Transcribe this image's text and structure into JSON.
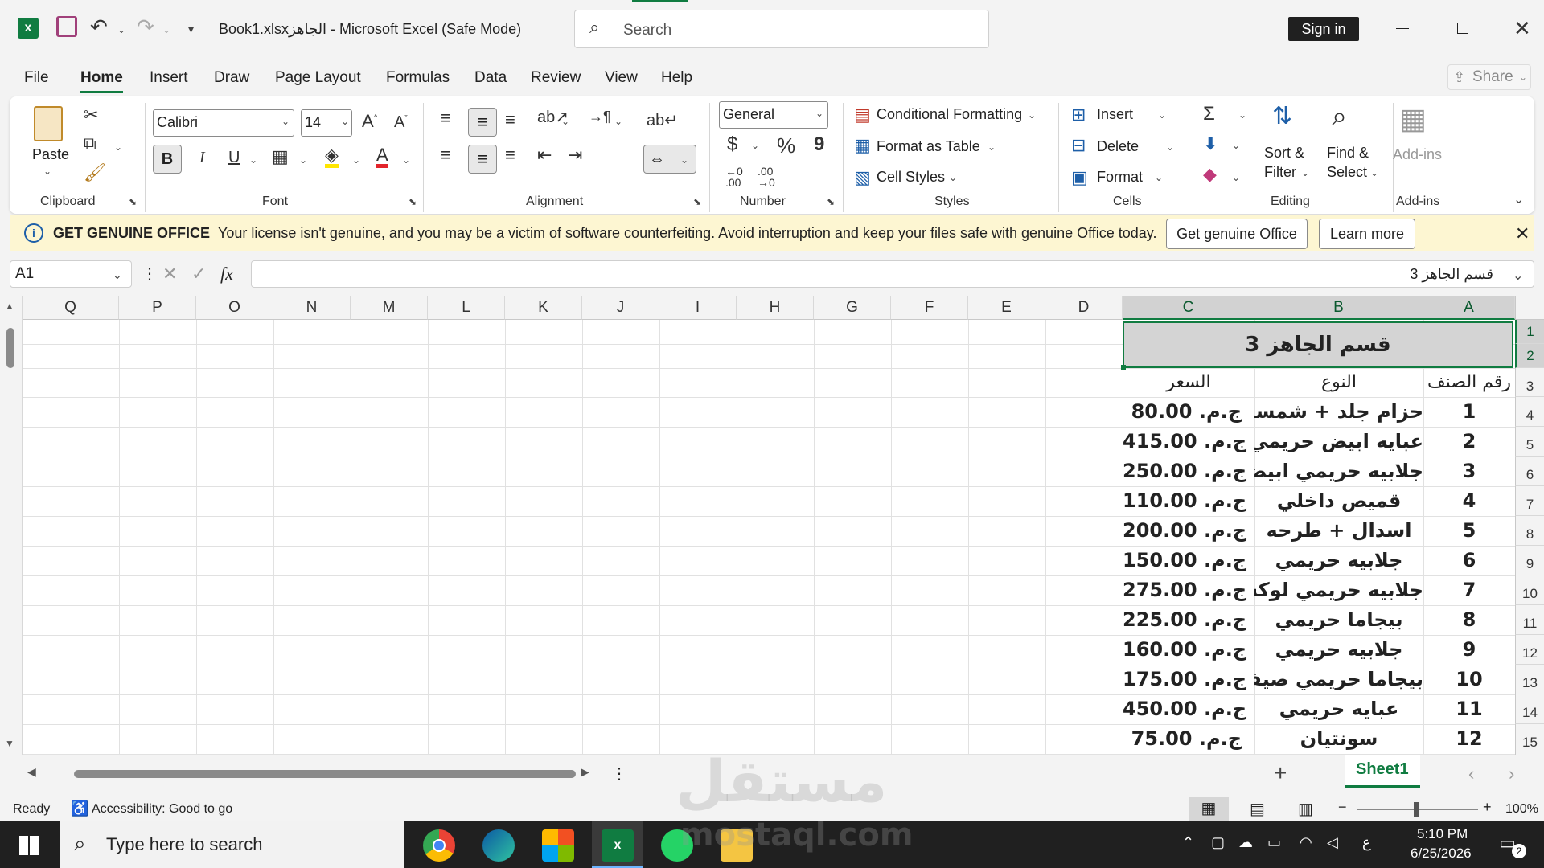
{
  "window": {
    "title": "Book1.xlsxالجاهز  -  Microsoft Excel (Safe Mode)",
    "search_placeholder": "Search",
    "sign_in": "Sign in"
  },
  "menu": {
    "tabs": [
      "File",
      "Home",
      "Insert",
      "Draw",
      "Page Layout",
      "Formulas",
      "Data",
      "Review",
      "View",
      "Help"
    ],
    "active": "Home",
    "share": "Share"
  },
  "ribbon": {
    "clipboard": {
      "paste": "Paste",
      "label": "Clipboard"
    },
    "font": {
      "name": "Calibri",
      "size": "14",
      "bold": "B",
      "italic": "I",
      "underline": "U",
      "label": "Font"
    },
    "alignment": {
      "label": "Alignment"
    },
    "number": {
      "format": "General",
      "currency": "$",
      "percent": "%",
      "comma": "9",
      "label": "Number"
    },
    "styles": {
      "conditional": "Conditional Formatting",
      "format_table": "Format as Table",
      "cell_styles": "Cell Styles",
      "label": "Styles"
    },
    "cells": {
      "insert": "Insert",
      "delete": "Delete",
      "format": "Format",
      "label": "Cells"
    },
    "editing": {
      "sort": "Sort &",
      "filter": "Filter",
      "find": "Find &",
      "select": "Select",
      "label": "Editing"
    },
    "addins": {
      "name": "Add-ins",
      "label": "Add-ins"
    }
  },
  "banner": {
    "title": "GET GENUINE OFFICE",
    "message": "Your license isn't genuine, and you may be a victim of software counterfeiting. Avoid interruption and keep your files safe with genuine Office today.",
    "get_btn": "Get genuine Office",
    "learn_btn": "Learn more"
  },
  "formula_bar": {
    "name_box": "A1",
    "fx": "fx",
    "content": "قسم الجاهز 3"
  },
  "grid": {
    "columns": [
      "Q",
      "P",
      "O",
      "N",
      "M",
      "L",
      "K",
      "J",
      "I",
      "H",
      "G",
      "F",
      "E",
      "D",
      "C",
      "B",
      "A"
    ],
    "rows": [
      "1",
      "2",
      "3",
      "4",
      "5",
      "6",
      "7",
      "8",
      "9",
      "10",
      "11",
      "12",
      "13",
      "14",
      "15"
    ],
    "merged_title": "قسم الجاهز 3",
    "headers": {
      "a": "رقم الصنف",
      "b": "النوع",
      "c": "السعر"
    },
    "items": [
      {
        "num": "1",
        "type": "حزام جلد + شمسيه",
        "price": "ج.م. 80.00"
      },
      {
        "num": "2",
        "type": "عبايه ابيض حريمي",
        "price": "ج.م. 415.00"
      },
      {
        "num": "3",
        "type": "جلابيه حريمي ابيض",
        "price": "ج.م. 250.00"
      },
      {
        "num": "4",
        "type": "قميص داخلي",
        "price": "ج.م. 110.00"
      },
      {
        "num": "5",
        "type": "اسدال + طرحه",
        "price": "ج.م. 200.00"
      },
      {
        "num": "6",
        "type": "جلابيه حريمي",
        "price": "ج.م. 150.00"
      },
      {
        "num": "7",
        "type": "جلابيه حريمي لوكس",
        "price": "ج.م. 275.00"
      },
      {
        "num": "8",
        "type": "بيجاما حريمي",
        "price": "ج.م. 225.00"
      },
      {
        "num": "9",
        "type": "جلابيه حريمي",
        "price": "ج.م. 160.00"
      },
      {
        "num": "10",
        "type": "بيجاما حريمي صيفي",
        "price": "ج.م. 175.00"
      },
      {
        "num": "11",
        "type": "عبايه حريمي",
        "price": "ج.م. 450.00"
      },
      {
        "num": "12",
        "type": "سونتيان",
        "price": "ج.م. 75.00"
      }
    ]
  },
  "sheets": {
    "add": "+",
    "tab": "Sheet1"
  },
  "status": {
    "ready": "Ready",
    "accessibility": "Accessibility: Good to go",
    "zoom": "100%"
  },
  "taskbar": {
    "search": "Type here to search",
    "time": "5:10 PM",
    "date": "6/25/2026",
    "lang": "ع",
    "notif": "2"
  },
  "watermark": {
    "ar": "مستقل",
    "en": "mostaql.com"
  }
}
